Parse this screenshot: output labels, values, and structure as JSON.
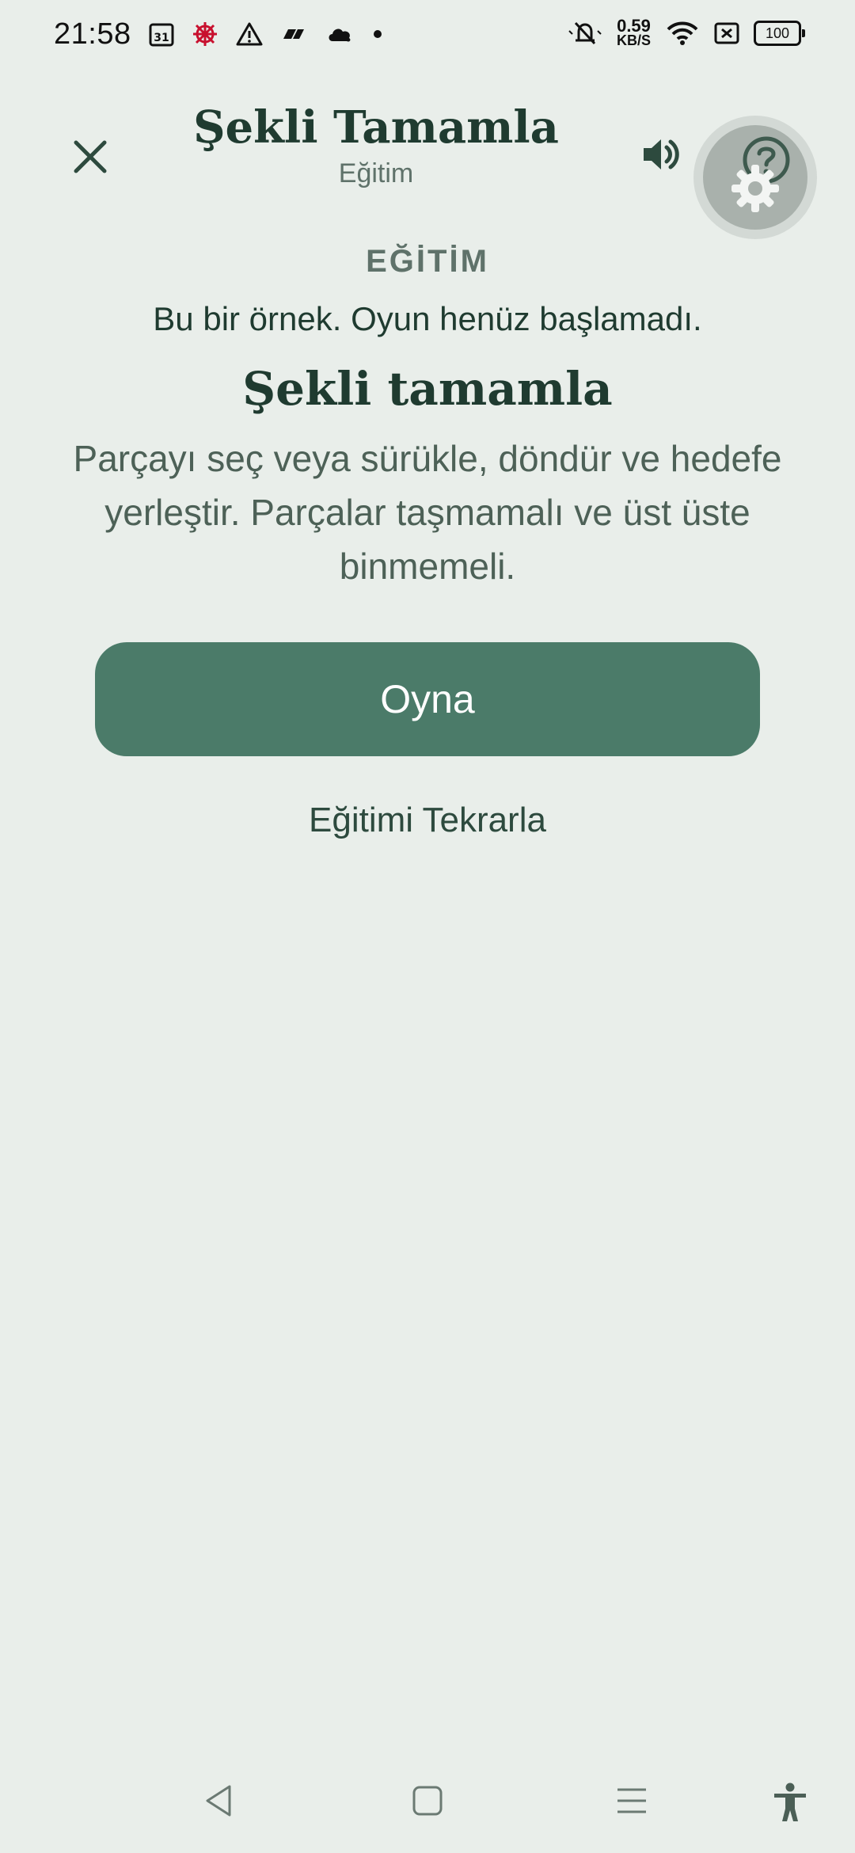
{
  "status_bar": {
    "time": "21:58",
    "calendar_day": "31",
    "net_speed_value": "0.59",
    "net_speed_unit": "KB/S",
    "battery": "100"
  },
  "header": {
    "title": "Şekli Tamamla",
    "subtitle": "Eğitim"
  },
  "tutorial": {
    "section_label": "EĞİTİM",
    "notice": "Bu bir örnek. Oyun henüz başlamadı.",
    "heading": "Şekli tamamla",
    "description": "Parçayı seç veya sürükle, döndür ve hedefe yerleştir. Parçalar taşmamalı ve üst üste binmemeli.",
    "play_label": "Oyna",
    "repeat_label": "Eğitimi Tekrarla"
  },
  "colors": {
    "background": "#e9eeea",
    "primary": "#4b7b69",
    "text_dark": "#1f3b30",
    "text_muted": "#5f726a"
  },
  "icons": {
    "close": "close-icon",
    "sound": "volume-icon",
    "help": "help-icon",
    "settings": "gear-icon",
    "nav_back": "back-triangle-icon",
    "nav_home": "home-square-icon",
    "nav_recents": "menu-lines-icon",
    "accessibility": "accessibility-icon"
  }
}
